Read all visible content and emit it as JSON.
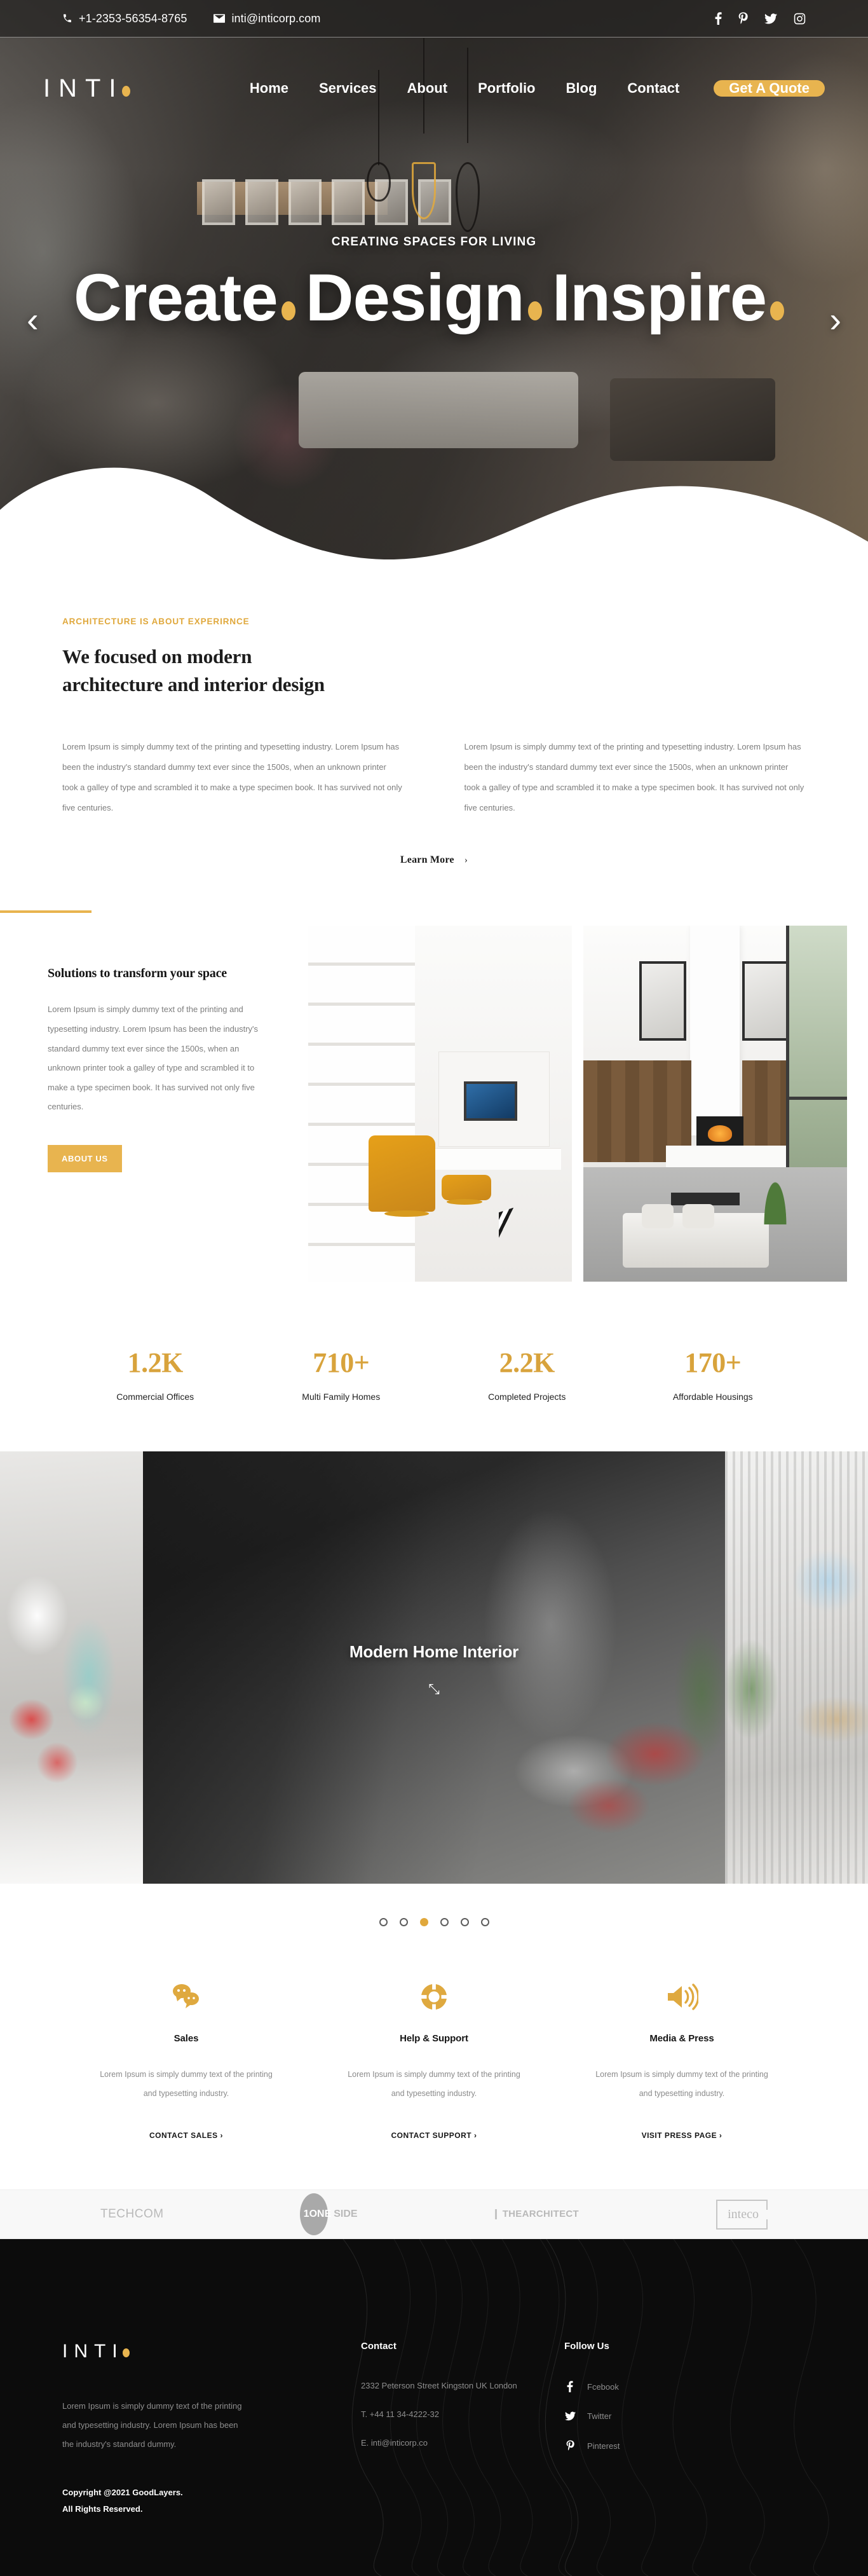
{
  "topbar": {
    "phone": "+1-2353-56354-8765",
    "email": "inti@inticorp.com",
    "social": [
      {
        "name": "facebook",
        "label": "Facebook"
      },
      {
        "name": "pinterest",
        "label": "Pinterest"
      },
      {
        "name": "twitter",
        "label": "Twitter"
      },
      {
        "name": "instagram",
        "label": "Instagram"
      }
    ]
  },
  "nav": {
    "logo": "INTI",
    "links": [
      "Home",
      "Services",
      "About",
      "Portfolio",
      "Blog",
      "Contact"
    ],
    "cta": "Get A Quote"
  },
  "hero": {
    "kicker": "CREATING SPACES FOR LIVING",
    "word1": "Create",
    "word2": "Design",
    "word3": "Inspire",
    "prev": "‹",
    "next": "›"
  },
  "focus": {
    "kicker": "ARCHITECTURE IS ABOUT EXPERIRNCE",
    "heading_line1": "We focused on modern",
    "heading_line2": "architecture and interior design",
    "col1": "Lorem Ipsum is simply dummy text of the printing and typesetting industry. Lorem Ipsum has been the industry's standard dummy text ever since the 1500s, when an unknown printer took a galley of type and scrambled it to make a type specimen book. It has survived not only five centuries.",
    "col2": "Lorem Ipsum is simply dummy text of the printing and typesetting industry. Lorem Ipsum has been the industry's standard dummy text ever since the 1500s, when an unknown printer took a galley of type and scrambled it to make a type specimen book. It has survived not only five centuries.",
    "learn_more": "Learn More",
    "learn_more_chevron": "›"
  },
  "solutions": {
    "heading": "Solutions to transform your space",
    "body": "Lorem Ipsum is simply dummy text of the printing and typesetting industry. Lorem Ipsum has been the industry's standard dummy text ever since the 1500s, when an unknown printer took a galley of type and scrambled it to make a type specimen book. It has survived not only five centuries.",
    "button": "ABOUT US"
  },
  "stats": [
    {
      "num": "1.2K",
      "label": "Commercial Offices"
    },
    {
      "num": "710+",
      "label": "Multi Family Homes"
    },
    {
      "num": "2.2K",
      "label": "Completed Projects"
    },
    {
      "num": "170+",
      "label": "Affordable Housings"
    }
  ],
  "gallery": {
    "caption": "Modern Home Interior",
    "expand_icon": "⤡",
    "dots_total": 6,
    "dots_active_index": 2
  },
  "services": [
    {
      "icon": "chat-bubbles-icon",
      "title": "Sales",
      "body": "Lorem Ipsum is simply dummy text of the printing and typesetting industry.",
      "cta": "CONTACT SALES ›"
    },
    {
      "icon": "lifebuoy-icon",
      "title": "Help & Support",
      "body": "Lorem Ipsum is simply dummy text of the printing and typesetting industry.",
      "cta": "CONTACT SUPPORT ›"
    },
    {
      "icon": "speaker-icon",
      "title": "Media & Press",
      "body": "Lorem Ipsum is simply dummy text of the printing and typesetting industry.",
      "cta": "VISIT PRESS PAGE ›"
    }
  ],
  "clients": {
    "techcom_bold": "TECH",
    "techcom_light": "COM",
    "oneside_1": "1ONE",
    "oneside_2": "SIDE",
    "architect_l1": "THE",
    "architect_l2": "ARCHITECT",
    "inteco": "inteco"
  },
  "footer": {
    "logo": "INTI",
    "description": "Lorem Ipsum is simply dummy text of the printing and typesetting industry. Lorem Ipsum has been the industry's standard dummy.",
    "copyright_line1": "Copyright @2021 GoodLayers.",
    "copyright_line2": "All Rights Reserved.",
    "contact_title": "Contact",
    "address": "2332 Peterson Street Kingston UK London",
    "phone": "T. +44 11 34-4222-32",
    "email": "E. inti@inticorp.co",
    "follow_title": "Follow Us",
    "follow": [
      {
        "icon": "facebook-icon",
        "label": "Fcebook"
      },
      {
        "icon": "twitter-icon",
        "label": "Twitter"
      },
      {
        "icon": "pinterest-icon",
        "label": "Pinterest"
      }
    ]
  },
  "colors": {
    "accent": "#e8b44f",
    "accent_dark": "#d8a33c",
    "footer_bg": "#0c0c0c"
  }
}
